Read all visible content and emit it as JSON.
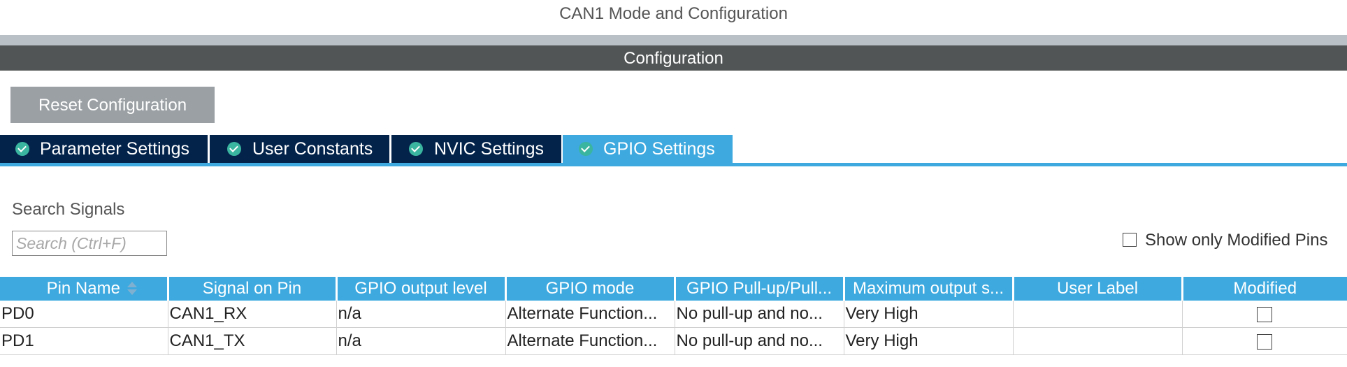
{
  "window": {
    "title": "CAN1 Mode and Configuration"
  },
  "section": {
    "title": "Configuration"
  },
  "toolbar": {
    "reset_label": "Reset Configuration"
  },
  "tabs": [
    {
      "label": "Parameter Settings",
      "active": false
    },
    {
      "label": "User Constants",
      "active": false
    },
    {
      "label": "NVIC Settings",
      "active": false
    },
    {
      "label": "GPIO Settings",
      "active": true
    }
  ],
  "search": {
    "label": "Search Signals",
    "placeholder": "Search (Ctrl+F)",
    "value": ""
  },
  "filter": {
    "modified_only_label": "Show only Modified Pins",
    "checked": false
  },
  "table": {
    "columns": [
      "Pin Name",
      "Signal on Pin",
      "GPIO output level",
      "GPIO mode",
      "GPIO Pull-up/Pull...",
      "Maximum output s...",
      "User Label",
      "Modified"
    ],
    "rows": [
      {
        "pin": "PD0",
        "signal": "CAN1_RX",
        "level": "n/a",
        "mode": "Alternate Function...",
        "pull": "No pull-up and no...",
        "speed": "Very High",
        "label": "",
        "modified": false
      },
      {
        "pin": "PD1",
        "signal": "CAN1_TX",
        "level": "n/a",
        "mode": "Alternate Function...",
        "pull": "No pull-up and no...",
        "speed": "Very High",
        "label": "",
        "modified": false
      }
    ]
  },
  "colors": {
    "tab_inactive": "#03234b",
    "tab_active": "#3da9df",
    "header_bar": "#525556",
    "check_icon": "#3ab59f"
  }
}
